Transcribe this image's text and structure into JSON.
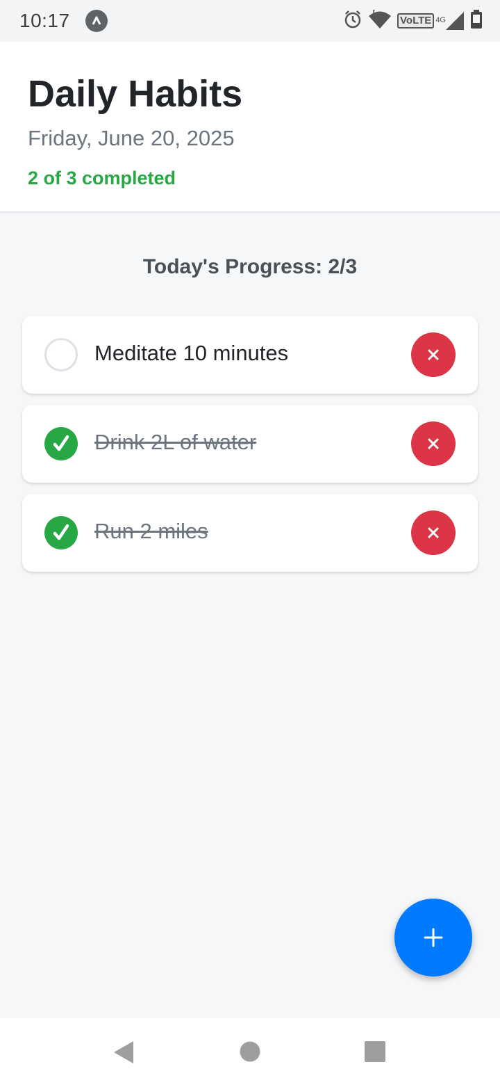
{
  "status_bar": {
    "time": "10:17",
    "volte_label": "VoLTE",
    "network_label": "4G",
    "icons": [
      "app-indicator-icon",
      "alarm-icon",
      "wifi-icon",
      "cell-signal-icon",
      "battery-icon"
    ]
  },
  "header": {
    "title": "Daily Habits",
    "date": "Friday, June 20, 2025",
    "completed_text": "2 of 3 completed"
  },
  "progress": {
    "title": "Today's Progress: 2/3"
  },
  "habits": [
    {
      "label": "Meditate 10 minutes",
      "done": false,
      "check_icon": "empty-circle-icon",
      "delete_icon": "close-icon"
    },
    {
      "label": "Drink 2L of water",
      "done": true,
      "check_icon": "checkmark-icon",
      "delete_icon": "close-icon"
    },
    {
      "label": "Run 2 miles",
      "done": true,
      "check_icon": "checkmark-icon",
      "delete_icon": "close-icon"
    }
  ],
  "fab": {
    "icon": "plus-icon"
  },
  "nav_bar": {
    "icons": [
      "back-icon",
      "home-icon",
      "recents-icon"
    ]
  },
  "colors": {
    "accent_blue": "#007bff",
    "success_green": "#28a745",
    "danger_red": "#dc3545",
    "background": "#f6f7f9",
    "title_text": "#212529",
    "muted_text": "#6c757d"
  }
}
